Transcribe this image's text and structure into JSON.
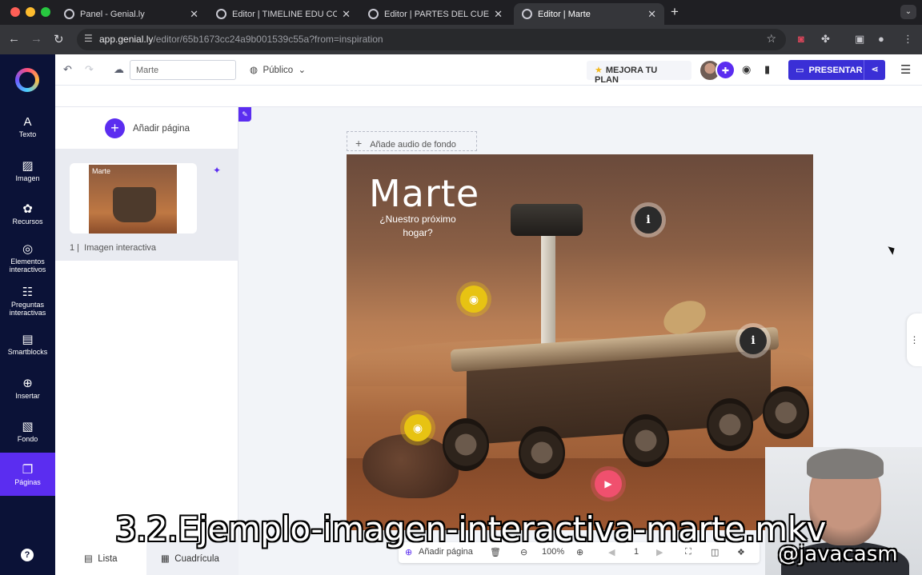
{
  "browser": {
    "tabs": [
      {
        "title": "Panel - Genial.ly",
        "active": false
      },
      {
        "title": "Editor | TIMELINE EDU COLOR",
        "active": false
      },
      {
        "title": "Editor | PARTES DEL CUERPO",
        "active": false
      },
      {
        "title": "Editor | Marte",
        "active": true
      }
    ],
    "url_host": "app.genial.ly",
    "url_path": "/editor/65b1673cc24a9b001539c55a?from=inspiration"
  },
  "rail": {
    "items": [
      {
        "label": "Texto",
        "icon": "text-icon"
      },
      {
        "label": "Imagen",
        "icon": "image-icon"
      },
      {
        "label": "Recursos",
        "icon": "resources-icon"
      },
      {
        "label": "Elementos interactivos",
        "icon": "interactive-elements-icon"
      },
      {
        "label": "Preguntas interactivas",
        "icon": "questions-icon"
      },
      {
        "label": "Smartblocks",
        "icon": "smartblocks-icon"
      },
      {
        "label": "Insertar",
        "icon": "insert-icon"
      },
      {
        "label": "Fondo",
        "icon": "background-icon"
      },
      {
        "label": "Páginas",
        "icon": "pages-icon",
        "active": true
      }
    ],
    "help": "?"
  },
  "toolbar": {
    "name_value": "Marte",
    "visibility": "Público",
    "upgrade": "MEJORA TU PLAN",
    "present": "PRESENTAR"
  },
  "panel": {
    "add_page": "Añadir página",
    "page_number": "1",
    "page_label": "Imagen interactiva",
    "thumb_title": "Marte",
    "view_list": "Lista",
    "view_grid": "Cuadrícula"
  },
  "canvas": {
    "add_audio": "Añade audio de fondo",
    "slide_title": "Marte",
    "slide_subtitle": "¿Nuestro próximo hogar?",
    "hotspots": [
      {
        "type": "info",
        "glyph": "i"
      },
      {
        "type": "info",
        "glyph": "i"
      },
      {
        "type": "eye",
        "glyph": "◉"
      },
      {
        "type": "eye",
        "glyph": "◉"
      },
      {
        "type": "play",
        "glyph": "▶"
      }
    ]
  },
  "bottombar": {
    "add_page": "Añadir página",
    "zoom": "100%",
    "page": "1"
  },
  "overlay": {
    "caption": "3.2.Ejemplo-imagen-interactiva-marte.mkv",
    "watermark": "@javacasm"
  }
}
